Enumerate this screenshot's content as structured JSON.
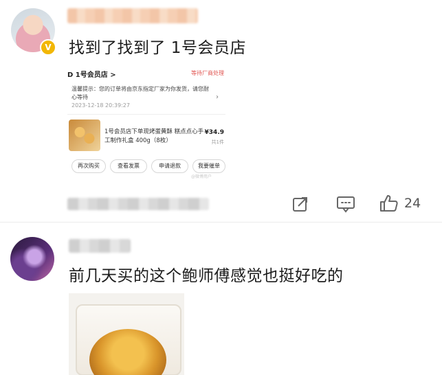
{
  "comments": [
    {
      "author_name_visible": "",
      "verified_badge": "V",
      "text": "找到了找到了 1号会员店",
      "embedded_order": {
        "store": "D 1号会员店 >",
        "status": "等待厂商处理",
        "notice": "温馨提示：您的订单将由京东指定厂家为你发货，请您耐心等待",
        "notice_time": "2023-12-18 20:39:27",
        "product_name": "1号会员店下单现烤蛋黄酥 糕点点心手工制作礼盒 400g（8枚）",
        "price": "¥34.9",
        "quantity": "共1件",
        "buttons": [
          "再次购买",
          "查看发票",
          "申请退款",
          "我要催单"
        ],
        "watermark": "@微博用户"
      },
      "actions": {
        "like_count": "24"
      }
    },
    {
      "author_name_visible": "",
      "text": "前几天买的这个鲍师傅感觉也挺好吃的"
    }
  ],
  "colors": {
    "accent_red": "#e0534f",
    "badge_gold": "#f2b705"
  }
}
